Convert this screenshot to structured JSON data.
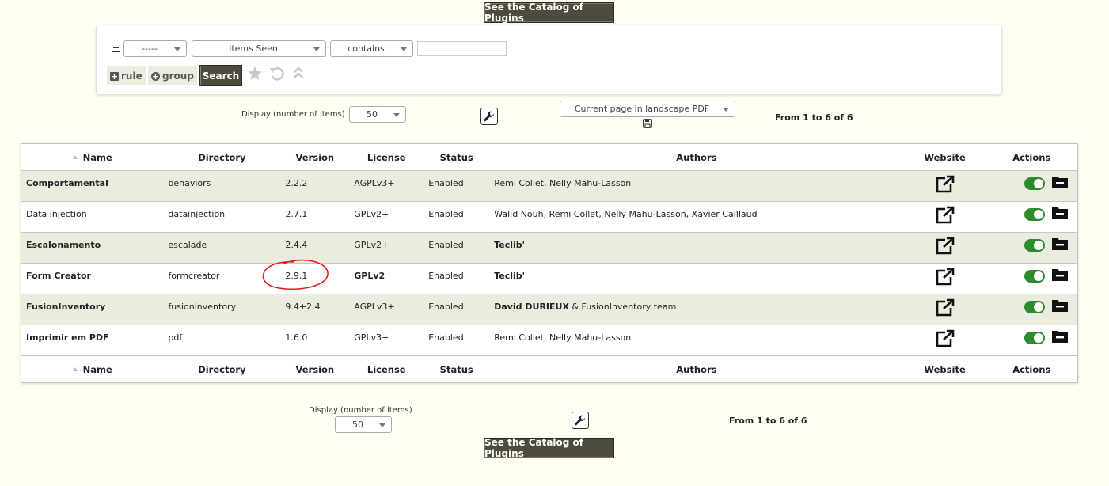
{
  "catalog_button_label": "See the Catalog of Plugins",
  "search": {
    "field_1": "-----",
    "field_2": "Items Seen",
    "operator": "contains",
    "value": "",
    "rule_label": "rule",
    "group_label": "group",
    "search_label": "Search"
  },
  "controls": {
    "display_label": "Display (number of items)",
    "display_value": "50",
    "export_label": "Current page in landscape PDF",
    "count_text": "From 1 to 6 of 6"
  },
  "table": {
    "headers": {
      "name": "Name",
      "directory": "Directory",
      "version": "Version",
      "license": "License",
      "status": "Status",
      "authors": "Authors",
      "website": "Website",
      "actions": "Actions"
    },
    "rows": [
      {
        "name": "Comportamental",
        "name_bold": true,
        "directory": "behaviors",
        "version": "2.2.2",
        "license": "AGPLv3+",
        "license_bold": false,
        "status": "Enabled",
        "authors_bold": "",
        "authors_rest": "Remi Collet, Nelly Mahu-Lasson"
      },
      {
        "name": "Data injection",
        "name_bold": false,
        "directory": "datainjection",
        "version": "2.7.1",
        "license": "GPLv2+",
        "license_bold": false,
        "status": "Enabled",
        "authors_bold": "",
        "authors_rest": "Walid Nouh, Remi Collet, Nelly Mahu-Lasson, Xavier Caillaud"
      },
      {
        "name": "Escalonamento",
        "name_bold": true,
        "directory": "escalade",
        "version": "2.4.4",
        "license": "GPLv2+",
        "license_bold": false,
        "status": "Enabled",
        "authors_bold": "Teclib'",
        "authors_rest": ""
      },
      {
        "name": "Form Creator",
        "name_bold": true,
        "directory": "formcreator",
        "version": "2.9.1",
        "license": "GPLv2",
        "license_bold": true,
        "status": "Enabled",
        "authors_bold": "Teclib'",
        "authors_rest": ""
      },
      {
        "name": "FusionInventory",
        "name_bold": true,
        "directory": "fusioninventory",
        "version": "9.4+2.4",
        "license": "AGPLv3+",
        "license_bold": false,
        "status": "Enabled",
        "authors_bold": "David DURIEUX",
        "authors_rest": " & FusionInventory team"
      },
      {
        "name": "Imprimir em PDF",
        "name_bold": true,
        "directory": "pdf",
        "version": "1.6.0",
        "license": "GPLv3+",
        "license_bold": false,
        "status": "Enabled",
        "authors_bold": "",
        "authors_rest": "Remi Collet, Nelly Mahu-Lasson"
      }
    ]
  },
  "colors": {
    "page_bg": "#fefef2",
    "button_dark": "#4d4b3e",
    "toggle_green": "#2d8a2d",
    "row_stripe": "#eaece0",
    "annotation_red": "#e02020"
  },
  "icons": {
    "website": "external-link-icon",
    "toggle": "toggle-on-icon",
    "folder": "folder-minus-icon",
    "favorite": "star-icon",
    "reset": "undo-icon",
    "collapse": "double-chevron-up-icon",
    "config": "wrench-icon",
    "save": "floppy-disk-icon"
  }
}
